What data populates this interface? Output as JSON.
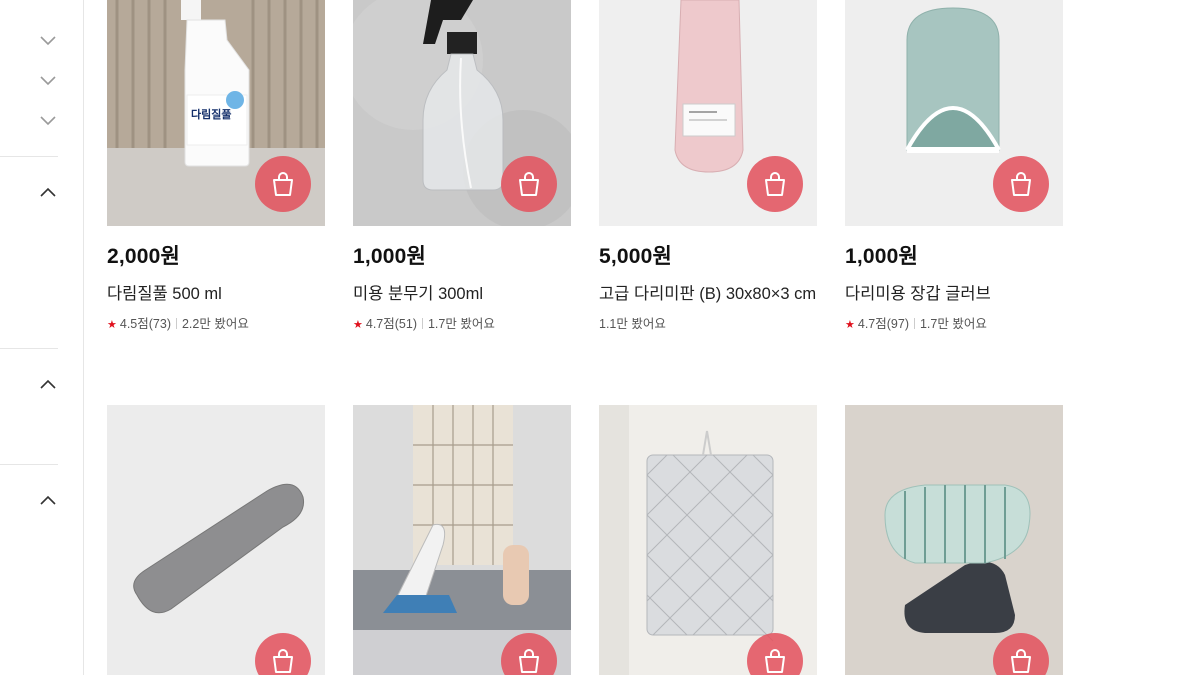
{
  "colors": {
    "accent": "#e25460",
    "star": "#e0101d"
  },
  "products": [
    {
      "price": "2,000원",
      "name": "다림질풀 500 ml",
      "rating": "4.5점(73)",
      "views": "2.2만 봤어요",
      "brand_text": "다림질풀"
    },
    {
      "price": "1,000원",
      "name": "미용 분무기 300ml",
      "rating": "4.7점(51)",
      "views": "1.7만 봤어요"
    },
    {
      "price": "5,000원",
      "name": "고급 다리미판 (B) 30x80×3 cm",
      "rating": "",
      "views": "1.1만 봤어요"
    },
    {
      "price": "1,000원",
      "name": "다리미용 장갑 글러브",
      "rating": "4.7점(97)",
      "views": "1.7만 봤어요"
    },
    {},
    {},
    {},
    {}
  ],
  "icons": {
    "filter_toggle": "chevron-icon",
    "cart": "shopping-bag-icon",
    "star": "star-icon"
  }
}
